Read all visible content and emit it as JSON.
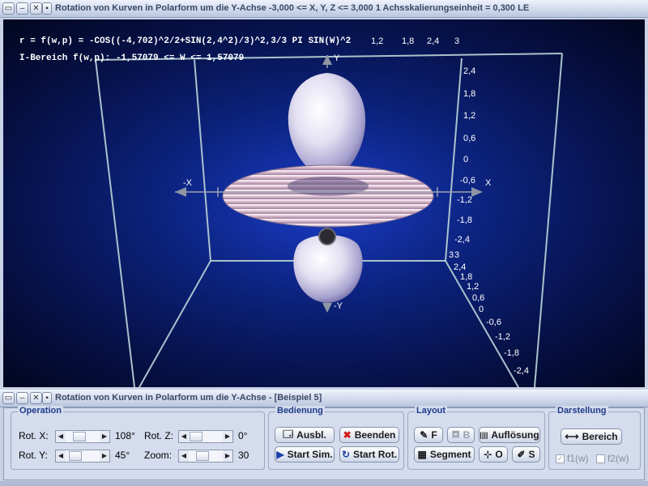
{
  "main_window": {
    "title": "Rotation von Kurven in Polarform um die Y-Achse   -3,000 <= X, Y, Z <= 3,000    1 Achsskalierungseinheit = 0,300 LE"
  },
  "viewport": {
    "formula": "r = f(w,p) = -COS((-4,702)^2/2+SIN(2,4^2)/3)^2,3/3 PI SIN(W)^2",
    "interval": "I-Bereich f(w,p): -1,57079 <= W <= 1,57079",
    "top_ticks": [
      "1,2",
      "1,8",
      "2,4",
      "3"
    ],
    "y_ticks_upper": [
      "2,4",
      "1,8",
      "1,2",
      "0,6",
      "0",
      "-0,6",
      "-1,2",
      "-1,8",
      "-2,4",
      "3"
    ],
    "y_ticks_lower": [
      "3",
      "2,4",
      "1,8",
      "1,2",
      "0,6",
      "0",
      "-0,6",
      "-1,2",
      "-1,8",
      "-2,4"
    ],
    "axis_labels": {
      "x_neg": "-X",
      "x_pos": "X",
      "y_pos": "Y",
      "y_neg": "-Y"
    }
  },
  "control_window": {
    "title": "Rotation von Kurven in Polarform um die Y-Achse - [Beispiel 5]",
    "operation": {
      "title": "Operation",
      "rot_x_label": "Rot. X:",
      "rot_x_value": "108°",
      "rot_y_label": "Rot. Y:",
      "rot_y_value": "45°",
      "rot_z_label": "Rot. Z:",
      "rot_z_value": "0°",
      "zoom_label": "Zoom:",
      "zoom_value": "30",
      "rot_x_level": 0.3,
      "rot_y_level": 0.125,
      "rot_z_level": 0.0,
      "zoom_level": 0.3
    },
    "bedienung": {
      "title": "Bedienung",
      "ausbl": "Ausbl.",
      "beenden": "Beenden",
      "start_sim": "Start Sim.",
      "start_rot": "Start Rot."
    },
    "layout": {
      "title": "Layout",
      "f": "F",
      "b": "B",
      "aufloesung": "Auflösung",
      "segment": "Segment",
      "o": "O",
      "s": "S"
    },
    "darstellung": {
      "title": "Darstellung",
      "bereich": "Bereich",
      "f1": "f1(w)",
      "f2": "f2(w)"
    }
  },
  "colors": {
    "titlebar_text": "#3a4866",
    "group_title": "#1e3a8a",
    "beenden_icon": "#d11a1a",
    "frame_line": "#a9c2cc"
  }
}
